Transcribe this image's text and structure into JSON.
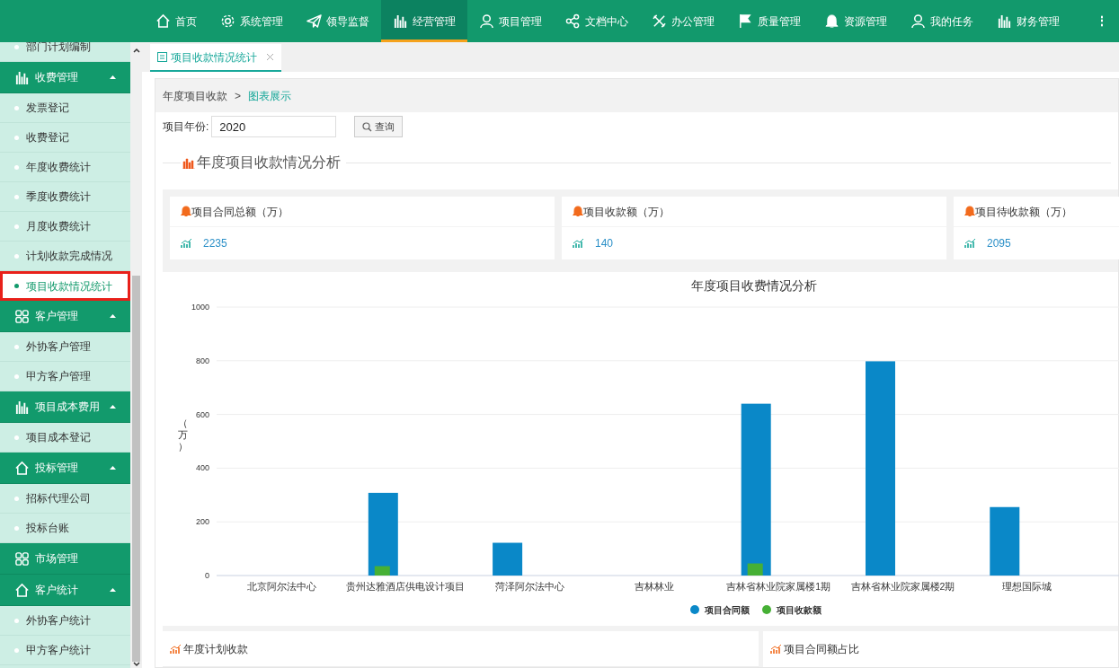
{
  "nav": [
    {
      "kind": "house",
      "label": "首页",
      "selected": false
    },
    {
      "kind": "gear",
      "label": "系统管理",
      "selected": false
    },
    {
      "kind": "plane",
      "label": "领导监督",
      "selected": false
    },
    {
      "kind": "bars",
      "label": "经营管理",
      "selected": true
    },
    {
      "kind": "person",
      "label": "项目管理",
      "selected": false
    },
    {
      "kind": "share",
      "label": "文档中心",
      "selected": false
    },
    {
      "kind": "tools",
      "label": "办公管理",
      "selected": false
    },
    {
      "kind": "flag",
      "label": "质量管理",
      "selected": false
    },
    {
      "kind": "bell",
      "label": "资源管理",
      "selected": false
    },
    {
      "kind": "person",
      "label": "我的任务",
      "selected": false
    },
    {
      "kind": "bars",
      "label": "财务管理",
      "selected": false
    }
  ],
  "nav_more": "⋮",
  "sidebar": {
    "items": [
      {
        "label": "部门计划编制",
        "selected": false
      }
    ],
    "groups": [
      {
        "kind": "bars",
        "label": "收费管理",
        "expanded": true,
        "children": [
          {
            "label": "发票登记",
            "selected": false
          },
          {
            "label": "收费登记",
            "selected": false
          },
          {
            "label": "年度收费统计",
            "selected": false
          },
          {
            "label": "季度收费统计",
            "selected": false
          },
          {
            "label": "月度收费统计",
            "selected": false
          },
          {
            "label": "计划收款完成情况",
            "selected": false
          },
          {
            "label": "项目收款情况统计",
            "selected": true
          }
        ]
      },
      {
        "kind": "grid",
        "label": "客户管理",
        "expanded": true,
        "children": [
          {
            "label": "外协客户管理",
            "selected": false
          },
          {
            "label": "甲方客户管理",
            "selected": false
          }
        ]
      },
      {
        "kind": "bars",
        "label": "项目成本费用",
        "expanded": true,
        "children": [
          {
            "label": "项目成本登记",
            "selected": false
          }
        ]
      },
      {
        "kind": "house",
        "label": "投标管理",
        "expanded": true,
        "children": [
          {
            "label": "招标代理公司",
            "selected": false
          },
          {
            "label": "投标台账",
            "selected": false
          }
        ]
      },
      {
        "kind": "grid",
        "label": "市场管理",
        "expanded": false
      },
      {
        "kind": "house",
        "label": "客户统计",
        "expanded": true,
        "children": [
          {
            "label": "外协客户统计",
            "selected": false
          },
          {
            "label": "甲方客户统计",
            "selected": false
          }
        ]
      }
    ]
  },
  "tabs": [
    {
      "label": "项目收款情况统计",
      "selected": true
    }
  ],
  "breadcrumb": {
    "items": [
      "年度项目收款",
      "图表展示"
    ],
    "separator": ">"
  },
  "query": {
    "label": "项目年份:",
    "value": "2020",
    "button": "查询"
  },
  "section_title": "年度项目收款情况分析",
  "stats": [
    {
      "title": "项目合同总额（万）",
      "value": "2235"
    },
    {
      "title": "项目收款额（万）",
      "value": "140"
    },
    {
      "title": "项目待收款额（万）",
      "value": "2095"
    }
  ],
  "chart_data": {
    "type": "bar",
    "title": "年度项目收费情况分析",
    "ylabel": "（万）",
    "categories": [
      "北京阿尔法中心",
      "贵州达雅酒店供电设计项目",
      "菏泽阿尔法中心",
      "吉林林业",
      "吉林省林业院家属楼1期",
      "吉林省林业院家属楼2期",
      "理想国际城"
    ],
    "series": [
      {
        "name": "项目合同额",
        "color": "#0a88c8",
        "values": [
          0,
          308,
          122,
          0,
          640,
          798,
          255
        ]
      },
      {
        "name": "项目收款额",
        "color": "#46b035",
        "values": [
          0,
          35,
          0,
          0,
          45,
          0,
          0
        ]
      }
    ],
    "ylim": [
      0,
      1000
    ],
    "yticks": [
      0,
      200,
      400,
      600,
      800,
      1000
    ],
    "grid": true,
    "legend": true
  },
  "bottom_panels": [
    {
      "title": "年度计划收款"
    },
    {
      "title": "项目合同额占比"
    }
  ]
}
